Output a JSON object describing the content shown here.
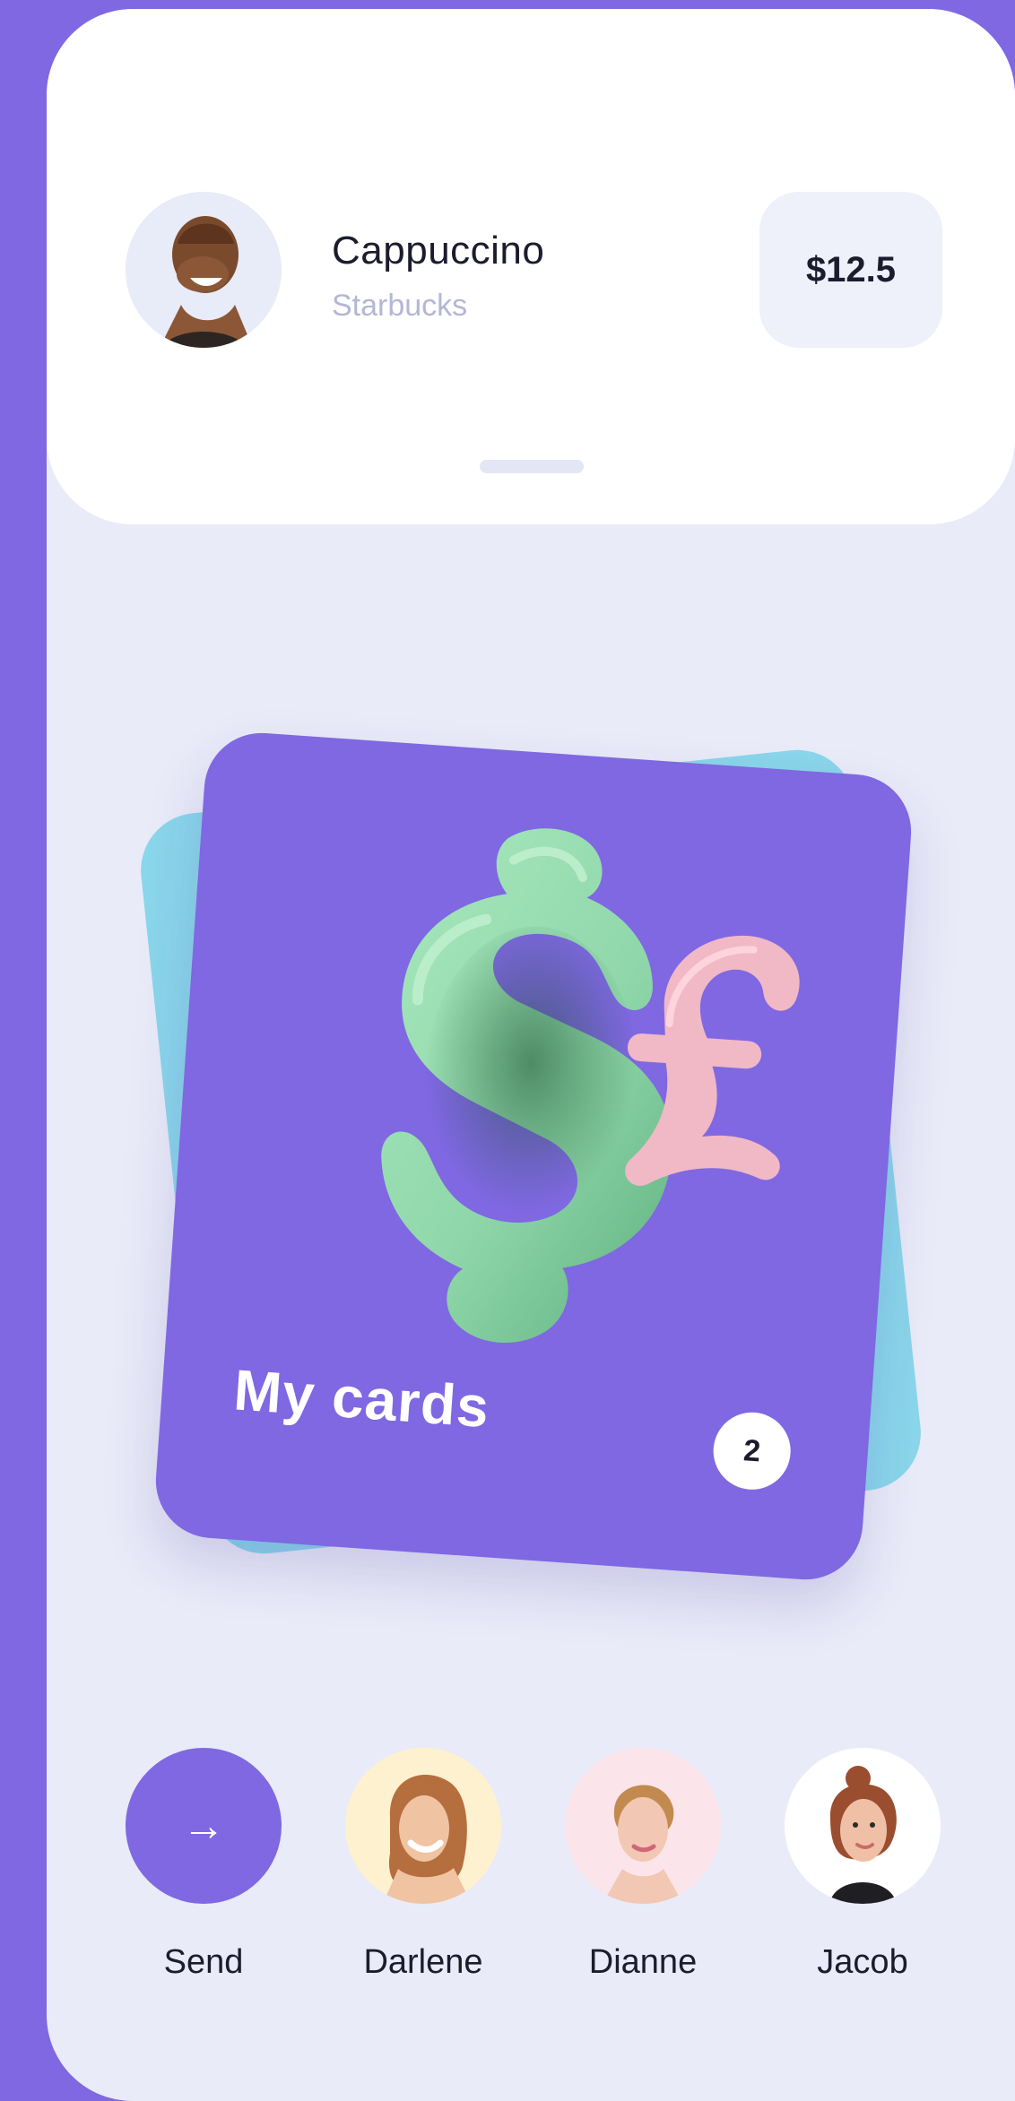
{
  "transaction": {
    "title": "Cappuccino",
    "merchant": "Starbucks",
    "amount": "$12.5",
    "avatar_icon": "person-avatar"
  },
  "card": {
    "title": "My cards",
    "count": "2",
    "illustration": "currency-symbols-illustration"
  },
  "contacts": [
    {
      "label": "Send",
      "icon": "arrow-right-icon",
      "bg": "#7f68e2"
    },
    {
      "label": "Darlene",
      "icon": "person-avatar",
      "bg": "#fdf1cf"
    },
    {
      "label": "Dianne",
      "icon": "person-avatar",
      "bg": "#fbe5ea"
    },
    {
      "label": "Jacob",
      "icon": "person-avatar",
      "bg": "#ffffff"
    }
  ],
  "colors": {
    "accent": "#7f68e2",
    "secondary_card": "#8ad6ea",
    "background": "#e9ebf8",
    "dollar": "#8ed7aa",
    "pound": "#f1b8c6"
  }
}
